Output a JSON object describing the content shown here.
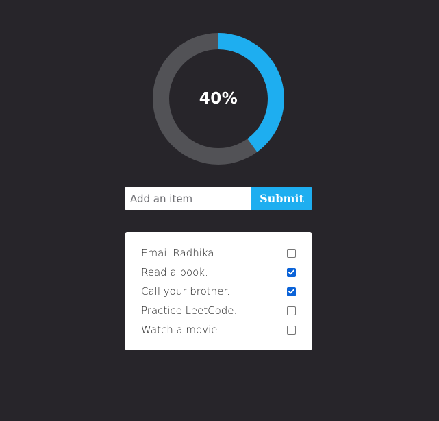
{
  "progress": {
    "percent": 40,
    "label": "40%",
    "track_color": "#525256",
    "fill_color": "#1eaef0"
  },
  "add_form": {
    "placeholder": "Add an item",
    "value": "",
    "submit_label": "Submit"
  },
  "todos": [
    {
      "text": "Email Radhika.",
      "checked": false
    },
    {
      "text": "Read a book.",
      "checked": true
    },
    {
      "text": "Call your brother.",
      "checked": true
    },
    {
      "text": "Practice LeetCode.",
      "checked": false
    },
    {
      "text": "Watch a movie.",
      "checked": false
    }
  ],
  "colors": {
    "background": "#27252a",
    "accent": "#1eaef0",
    "checkbox_checked": "#0b63d8"
  }
}
